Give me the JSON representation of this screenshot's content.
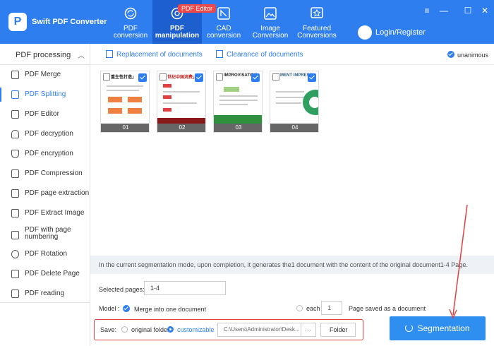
{
  "app": {
    "name": "Swift PDF Converter",
    "logo_letter": "P"
  },
  "tabs": [
    {
      "line1": "PDF",
      "line2": "conversion",
      "icon": "refresh-icon"
    },
    {
      "line1": "PDF",
      "line2": "manipulation",
      "icon": "gear-icon",
      "badge": "PDF Editor"
    },
    {
      "line1": "CAD",
      "line2": "conversion",
      "icon": "cad-icon"
    },
    {
      "line1": "Image",
      "line2": "Conversion",
      "icon": "image-icon"
    },
    {
      "line1": "Featured",
      "line2": "Conversions",
      "icon": "star-icon"
    }
  ],
  "login_label": "Login/Register",
  "window_controls": [
    "≡",
    "—",
    "☐",
    "✕"
  ],
  "sidebar": {
    "header": "PDF processing",
    "items": [
      {
        "label": "PDF Merge"
      },
      {
        "label": "PDF Splitting"
      },
      {
        "label": "PDF Editor"
      },
      {
        "label": "PDF decryption"
      },
      {
        "label": "PDF encryption"
      },
      {
        "label": "PDF Compression"
      },
      {
        "label": "PDF page extraction"
      },
      {
        "label": "PDF Extract Image"
      },
      {
        "label": "PDF with page",
        "label2": "numbering"
      },
      {
        "label": "PDF Rotation"
      },
      {
        "label": "PDF Delete Page"
      },
      {
        "label": "PDF reading"
      }
    ]
  },
  "toolbar": {
    "replace": "Replacement of documents",
    "clear": "Clearance of documents",
    "unanimous": "unanimous"
  },
  "pages": [
    {
      "num": "01",
      "title": "重生性打造」"
    },
    {
      "num": "02",
      "title": "世纪中国消费」"
    },
    {
      "num": "03",
      "title": "IMPROVISATION"
    },
    {
      "num": "04",
      "title": "MENT IMPRESSI"
    }
  ],
  "info": "In the current segmentation mode, upon completion, it generates the1 document with the content of the original document1-4 Page.",
  "selected_pages": {
    "label": "Selected pages:",
    "value": "1-4"
  },
  "model": {
    "label": "Model :",
    "merge": "Merge into one document",
    "each": "each",
    "each_value": "1",
    "each_suffix": "Page saved as a document"
  },
  "save": {
    "label": "Save:",
    "original": "original folder",
    "custom": "customizable",
    "path": "C:\\Users\\Administrator\\Desk...",
    "more": "···",
    "folder": "Folder"
  },
  "segmentation_button": "Segmentation"
}
